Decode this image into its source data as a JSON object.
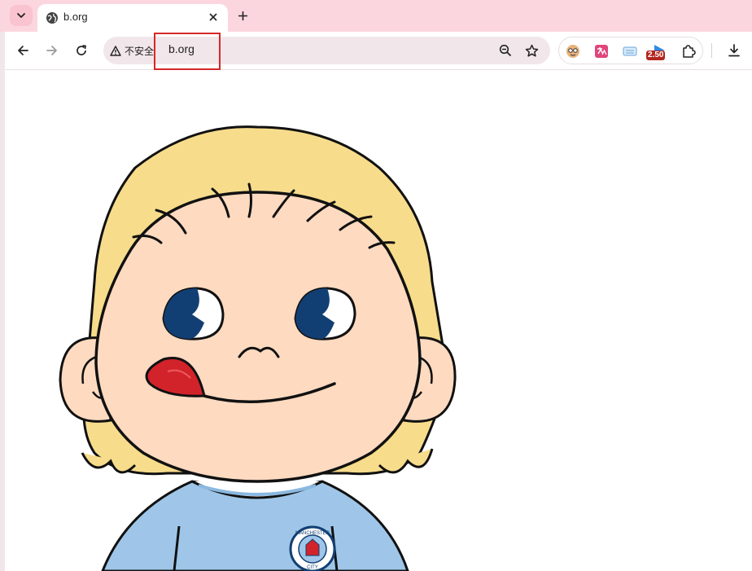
{
  "browser": {
    "tab": {
      "title": "b.org"
    },
    "address_bar": {
      "security_label": "不安全",
      "url": "b.org"
    },
    "extensions": {
      "badge": "2.50"
    }
  },
  "page": {
    "image": {
      "crest_text_top": "MANCHESTER",
      "crest_text_bottom": "CITY"
    }
  },
  "colors": {
    "tab_strip": "#fcd6df",
    "omnibox": "#f1e6ea",
    "highlight": "#d62828",
    "hair": "#f7dc8c",
    "skin": "#fedac0",
    "shirt": "#9fc6e8",
    "eye_blue": "#123f73",
    "tongue": "#d2232a"
  }
}
